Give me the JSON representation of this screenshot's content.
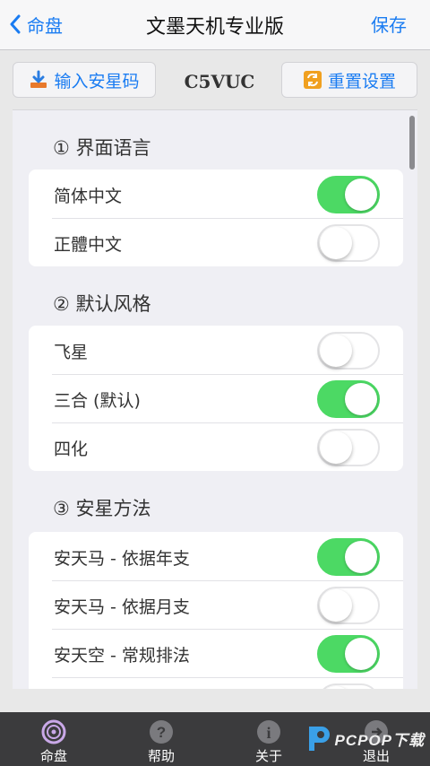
{
  "nav": {
    "back_label": "命盘",
    "title": "文墨天机专业版",
    "save_label": "保存"
  },
  "toolbar": {
    "import_label": "输入安星码",
    "code": "C5VUC",
    "reset_label": "重置设置"
  },
  "sections": [
    {
      "title": "① 界面语言",
      "rows": [
        {
          "label": "简体中文",
          "on": true
        },
        {
          "label": "正體中文",
          "on": false
        }
      ]
    },
    {
      "title": "② 默认风格",
      "rows": [
        {
          "label": "飞星",
          "on": false
        },
        {
          "label": "三合 (默认)",
          "on": true
        },
        {
          "label": "四化",
          "on": false
        }
      ]
    },
    {
      "title": "③ 安星方法",
      "rows": [
        {
          "label": "安天马 - 依据年支",
          "on": true
        },
        {
          "label": "安天马 - 依据月支",
          "on": false
        },
        {
          "label": "安天空 - 常规排法",
          "on": true
        }
      ]
    }
  ],
  "tabs": [
    {
      "label": "命盘",
      "icon": "disc-icon"
    },
    {
      "label": "帮助",
      "icon": "help-icon"
    },
    {
      "label": "关于",
      "icon": "info-icon"
    },
    {
      "label": "退出",
      "icon": "exit-icon"
    }
  ],
  "watermark": {
    "text": "PCPOP下载"
  },
  "colors": {
    "accent": "#1a7cf2",
    "switch_on": "#4cd964",
    "tabbar": "#3b3b3d"
  }
}
